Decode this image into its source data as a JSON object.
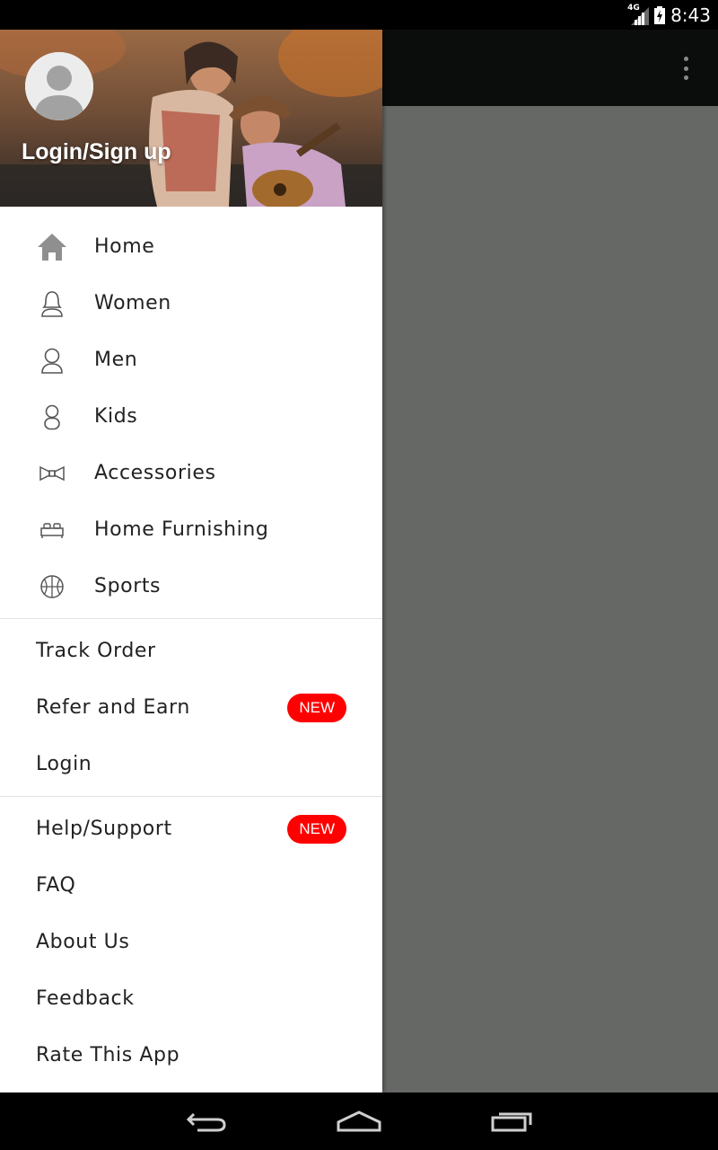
{
  "status_bar": {
    "network": "4G",
    "time": "8:43"
  },
  "app_bar": {
    "overflow_icon": "more-vert-icon"
  },
  "drawer": {
    "header": {
      "avatar_icon": "person-icon",
      "login_label": "Login/Sign up"
    },
    "categories": [
      {
        "label": "Home",
        "icon": "home-icon"
      },
      {
        "label": "Women",
        "icon": "woman-icon"
      },
      {
        "label": "Men",
        "icon": "man-icon"
      },
      {
        "label": "Kids",
        "icon": "kid-icon"
      },
      {
        "label": "Accessories",
        "icon": "bow-tie-icon"
      },
      {
        "label": "Home Furnishing",
        "icon": "bed-icon"
      },
      {
        "label": "Sports",
        "icon": "basketball-icon"
      }
    ],
    "account_items": [
      {
        "label": "Track Order"
      },
      {
        "label": "Refer and Earn",
        "badge": "NEW"
      },
      {
        "label": "Login"
      }
    ],
    "support_items": [
      {
        "label": "Help/Support",
        "badge": "NEW"
      },
      {
        "label": "FAQ"
      },
      {
        "label": "About Us"
      },
      {
        "label": "Feedback"
      },
      {
        "label": "Rate This App"
      }
    ]
  },
  "nav_bar": {
    "back_icon": "back-icon",
    "home_icon": "home-nav-icon",
    "recents_icon": "recents-icon"
  },
  "colors": {
    "badge": "#ff0000",
    "scrim": "#666866",
    "app_bar": "#0b0d0c"
  }
}
